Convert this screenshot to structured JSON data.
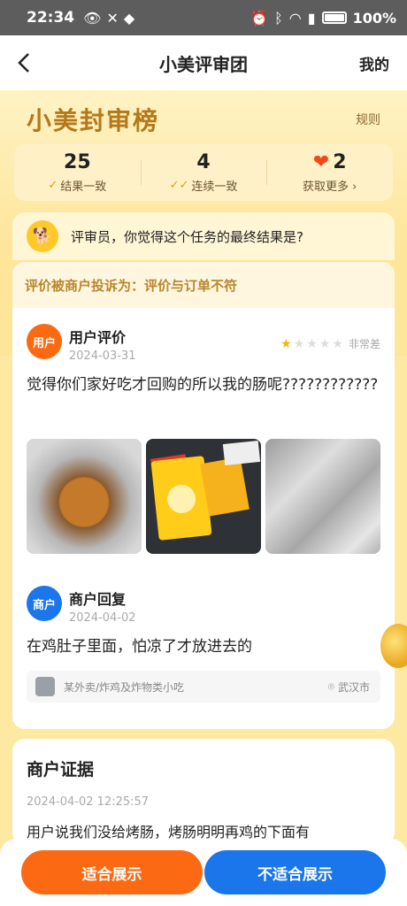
{
  "status_bar": {
    "time": "22:34",
    "battery": "100%"
  },
  "nav": {
    "title": "小美评审团",
    "mine": "我的"
  },
  "header": {
    "brand": "小美封审榜",
    "rules": "规则",
    "stats": [
      {
        "value": "25",
        "label": "结果一致"
      },
      {
        "value": "4",
        "label": "连续一致"
      },
      {
        "value": "2",
        "label": "获取更多 ›"
      }
    ]
  },
  "question": "评审员，你觉得这个任务的最终结果是?",
  "complaint": "评价被商户投诉为：评价与订单不符",
  "user_review": {
    "avatar": "用户",
    "title": "用户评价",
    "date": "2024-03-31",
    "rating": 1,
    "rating_label": "非常差",
    "text": "觉得你们家好吃才回购的所以我的肠呢????????????"
  },
  "merchant_reply": {
    "avatar": "商户",
    "title": "商户回复",
    "date": "2024-04-02",
    "text": "在鸡肚子里面，怕凉了才放进去的"
  },
  "shop": {
    "category": "某外卖/炸鸡及炸物类小吃",
    "city": "武汉市"
  },
  "evidence": {
    "title": "商户证据",
    "time": "2024-04-02 12:25:57",
    "text": "用户说我们没给烤肠，烤肠明明再鸡的下面有"
  },
  "actions": {
    "suitable": "适合展示",
    "unsuitable": "不适合展示"
  }
}
